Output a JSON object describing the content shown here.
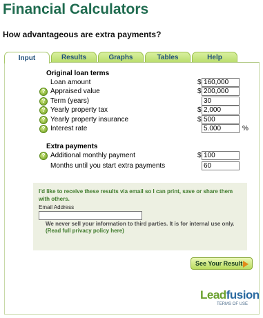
{
  "header": {
    "title": "Financial Calculators",
    "question": "How advantageous are extra payments?"
  },
  "tabs": [
    {
      "label": "Input",
      "active": true
    },
    {
      "label": "Results",
      "active": false
    },
    {
      "label": "Graphs",
      "active": false
    },
    {
      "label": "Tables",
      "active": false
    },
    {
      "label": "Help",
      "active": false
    }
  ],
  "loan_terms": {
    "heading": "Original loan terms",
    "rows": [
      {
        "label": "Loan amount",
        "prefix": "$",
        "value": "160,000",
        "help": false
      },
      {
        "label": "Appraised value",
        "prefix": "$",
        "value": "200,000",
        "help": true
      },
      {
        "label": "Term (years)",
        "prefix": "",
        "value": "30",
        "help": true
      },
      {
        "label": "Yearly property tax",
        "prefix": "$",
        "value": "2,000",
        "help": true
      },
      {
        "label": "Yearly property insurance",
        "prefix": "$",
        "value": "500",
        "help": true
      },
      {
        "label": "Interest rate",
        "prefix": "",
        "value": "5.000",
        "suffix": "%",
        "help": true
      }
    ]
  },
  "extra_payments": {
    "heading": "Extra payments",
    "rows": [
      {
        "label": "Additional monthly payment",
        "prefix": "$",
        "value": "100",
        "help": true
      },
      {
        "label": "Months until you start extra payments",
        "prefix": "",
        "value": "60",
        "help": false
      }
    ]
  },
  "email": {
    "message": "I'd like to receive these results via email so I can print, save or share them with others.",
    "field_label": "Email Address",
    "field_value": "",
    "privacy": "We never sell your information to third parties. It is for internal use only.",
    "privacy_link": "(Read full privacy policy here)"
  },
  "submit_label": "See Your Results",
  "logo": {
    "word_part1": "Lead",
    "word_part2": "fusion",
    "terms": "TERMS OF USE"
  },
  "colors": {
    "title_green": "#1f6b4f",
    "tab_green": "#b8dc6a",
    "button_arrow": "#e28a1a"
  }
}
